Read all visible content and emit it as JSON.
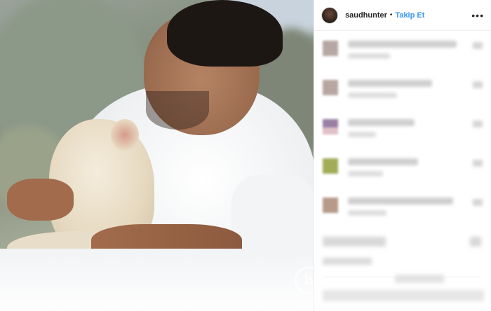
{
  "post": {
    "username": "saudhunter",
    "separator": "•",
    "follow_label": "Takip Et",
    "more_label": "•••"
  },
  "photo": {
    "watermark_letter": "b"
  },
  "comments_blurred": [
    {
      "avatar_color": "#b7a7a4"
    },
    {
      "avatar_color": "#b9a6a3"
    },
    {
      "avatar_color": "#9a7fa5"
    },
    {
      "avatar_color": "#a3ad58"
    },
    {
      "avatar_color": "#b79a8a"
    }
  ]
}
